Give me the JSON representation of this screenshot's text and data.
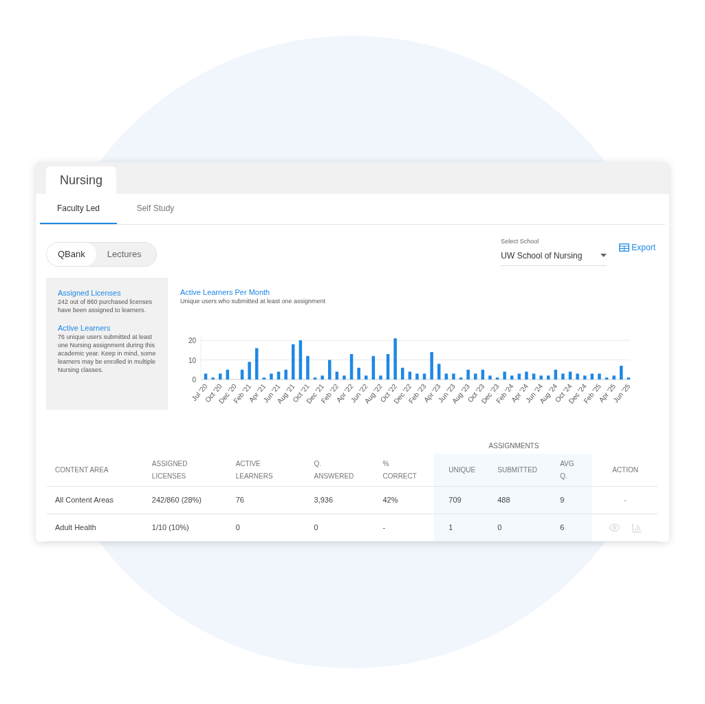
{
  "header_tab": "Nursing",
  "tabs": [
    {
      "label": "Faculty Led",
      "selected": true
    },
    {
      "label": "Self Study",
      "selected": false
    }
  ],
  "toggle": [
    {
      "label": "QBank",
      "selected": true
    },
    {
      "label": "Lectures",
      "selected": false
    }
  ],
  "school_select": {
    "label": "Select School",
    "value": "UW School of Nursing"
  },
  "export_button": "Export",
  "summary": [
    {
      "title": "Assigned Licenses",
      "text": "242 out of 860 purchased licenses have been assigned to learners."
    },
    {
      "title": "Active Learners",
      "text": "76 unique users submitted at least one Nursing assignment during this academic year. Keep in mind, some learners may be enrolled in multiple Nursing classes."
    }
  ],
  "chart": {
    "title": "Active Learners Per Month",
    "subtitle": "Unique users who submitted at least one assignment",
    "chart_data": {
      "type": "bar",
      "ylim": [
        0,
        22
      ],
      "yticks": [
        0,
        10,
        20
      ],
      "categories": [
        "Jul '20",
        null,
        "Oct '20",
        null,
        "Dec '20",
        null,
        "Feb '21",
        null,
        "Apr '21",
        null,
        "Jun '21",
        null,
        "Aug '21",
        null,
        "Oct '21",
        null,
        "Dec '21",
        null,
        "Feb '22",
        null,
        "Apr '22",
        null,
        "Jun '22",
        null,
        "Aug '22",
        null,
        "Oct '22",
        null,
        "Dec '22",
        null,
        "Feb '23",
        null,
        "Apr '23",
        null,
        "Jun '23",
        null,
        "Aug '23",
        null,
        "Oct '23",
        null,
        "Dec '23",
        null,
        "Feb '24",
        null,
        "Apr '24",
        null,
        "Jun '24",
        null,
        "Aug '24",
        null,
        "Oct '24",
        null,
        "Dec '24",
        null,
        "Feb '25",
        null,
        "Apr '25",
        null,
        "Jun '25"
      ],
      "series": [
        {
          "color": "#1e88e5",
          "values": [
            3,
            1,
            3,
            5,
            0,
            5,
            9,
            16,
            1,
            3,
            4,
            5,
            18,
            20,
            12,
            1,
            2,
            10,
            4,
            2,
            13,
            6,
            2,
            12,
            2,
            13,
            21,
            6,
            4,
            3,
            3,
            14,
            8,
            3,
            3,
            1,
            5,
            3,
            5,
            2,
            1,
            4,
            2,
            3,
            4,
            3,
            2,
            2,
            5,
            3,
            4,
            3,
            2,
            3,
            3,
            1,
            2,
            7,
            1
          ]
        }
      ]
    }
  },
  "table": {
    "group_header": "ASSIGNMENTS",
    "columns": [
      {
        "label": [
          "CONTENT AREA"
        ]
      },
      {
        "label": [
          "ASSIGNED",
          "LICENSES"
        ]
      },
      {
        "label": [
          "ACTIVE",
          "LEARNERS"
        ]
      },
      {
        "label": [
          "Q.",
          "ANSWERED"
        ]
      },
      {
        "label": [
          "%",
          "CORRECT"
        ]
      },
      {
        "label": [
          "UNIQUE"
        ]
      },
      {
        "label": [
          "SUBMITTED"
        ]
      },
      {
        "label": [
          "AVG",
          "Q."
        ]
      },
      {
        "label": [
          "ACTION"
        ]
      }
    ],
    "rows": [
      {
        "cells": [
          "All Content Areas",
          "242/860 (28%)",
          "76",
          "3,936",
          "42%",
          "709",
          "488",
          "9"
        ],
        "action": {
          "kind": "text",
          "text": "-"
        }
      },
      {
        "cells": [
          "Adult Health",
          "1/10 (10%)",
          "0",
          "0",
          "-",
          "1",
          "0",
          "6"
        ],
        "action": {
          "kind": "icons"
        }
      }
    ]
  }
}
